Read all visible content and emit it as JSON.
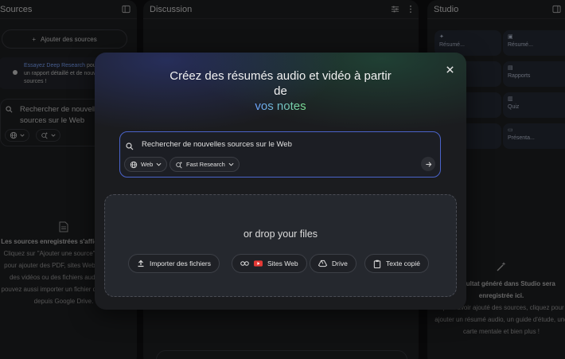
{
  "sources_panel": {
    "title": "Sources",
    "add_button": "Ajouter des sources",
    "deep_research": {
      "link": "Essayez Deep Research",
      "text_1": " pour",
      "text_2": "un rapport détaillé et de nouvelles",
      "text_3": "sources !"
    },
    "search_placeholder": "Rechercher de nouvelles sources sur le Web",
    "empty_title": "Les sources enregistrées s'afficheront ici",
    "empty_text": "Cliquez sur \"Ajouter une source\" ci-dessus pour ajouter des PDF, sites Web, du texte, des vidéos ou des fichiers audio. Vous pouvez aussi importer un fichier directement depuis Google Drive."
  },
  "discussion_panel": {
    "title": "Discussion"
  },
  "studio_panel": {
    "title": "Studio",
    "tiles": [
      "Résumé...",
      "Résumé...",
      "",
      "Rapports",
      "",
      "Quiz",
      "",
      "Présenta..."
    ],
    "empty_title": "Le résultat généré dans Studio sera enregistrée ici.",
    "empty_text": "Après avoir ajouté des sources, cliquez pour ajouter un résumé audio, un guide d'étude, une carte mentale et bien plus !"
  },
  "modal": {
    "title_line1": "Créez des résumés audio et vidéo à partir",
    "title_line2": "de",
    "title_highlight": "vos notes",
    "search_placeholder": "Rechercher de nouvelles sources sur le Web",
    "chip_web": "Web",
    "chip_research": "Fast Research",
    "drop_text": "or drop your files",
    "buttons": {
      "import": "Importer des fichiers",
      "websites": "Sites Web",
      "drive": "Drive",
      "copied_text": "Texte copié"
    }
  },
  "colors": {
    "accent_blue": "#6aa0ff",
    "accent_green": "#7be08f",
    "search_border": "#4a63c9"
  }
}
